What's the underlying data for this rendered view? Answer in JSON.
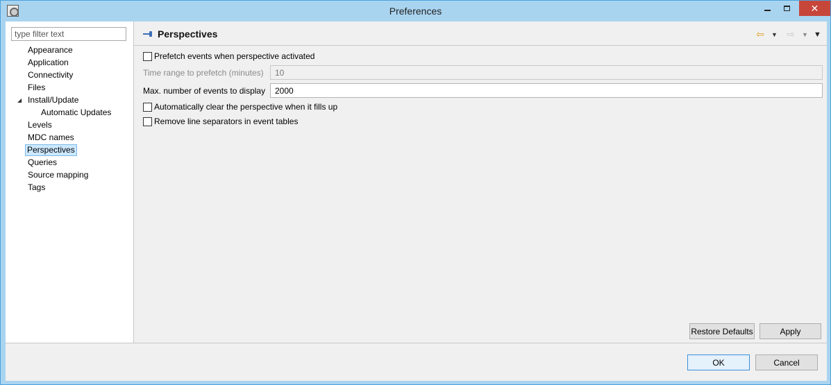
{
  "window": {
    "title": "Preferences"
  },
  "titlebar": {
    "minimize": "minimize",
    "maximize": "maximize",
    "close": "✕"
  },
  "filter": {
    "placeholder": "type filter text",
    "value": ""
  },
  "tree": {
    "items": [
      {
        "label": "Appearance"
      },
      {
        "label": "Application"
      },
      {
        "label": "Connectivity"
      },
      {
        "label": "Files"
      },
      {
        "label": "Install/Update",
        "expanded": true
      },
      {
        "label": "Automatic Updates",
        "child": true
      },
      {
        "label": "Levels"
      },
      {
        "label": "MDC names"
      },
      {
        "label": "Perspectives",
        "selected": true
      },
      {
        "label": "Queries"
      },
      {
        "label": "Source mapping"
      },
      {
        "label": "Tags"
      }
    ]
  },
  "page": {
    "title": "Perspectives",
    "icons": {
      "back": "back-arrow-icon",
      "forward": "forward-arrow-icon",
      "menu": "view-menu-icon"
    },
    "prefetch_label": "Prefetch events when perspective activated",
    "prefetch_checked": false,
    "time_range_label": "Time range to prefetch (minutes)",
    "time_range_value": "10",
    "max_events_label": "Max. number of events to display",
    "max_events_value": "2000",
    "auto_clear_label": "Automatically clear the perspective when it fills up",
    "auto_clear_checked": false,
    "remove_separators_label": "Remove line separators in event tables",
    "remove_separators_checked": false,
    "restore_defaults": "Restore Defaults",
    "apply": "Apply"
  },
  "dialog": {
    "ok": "OK",
    "cancel": "Cancel"
  }
}
